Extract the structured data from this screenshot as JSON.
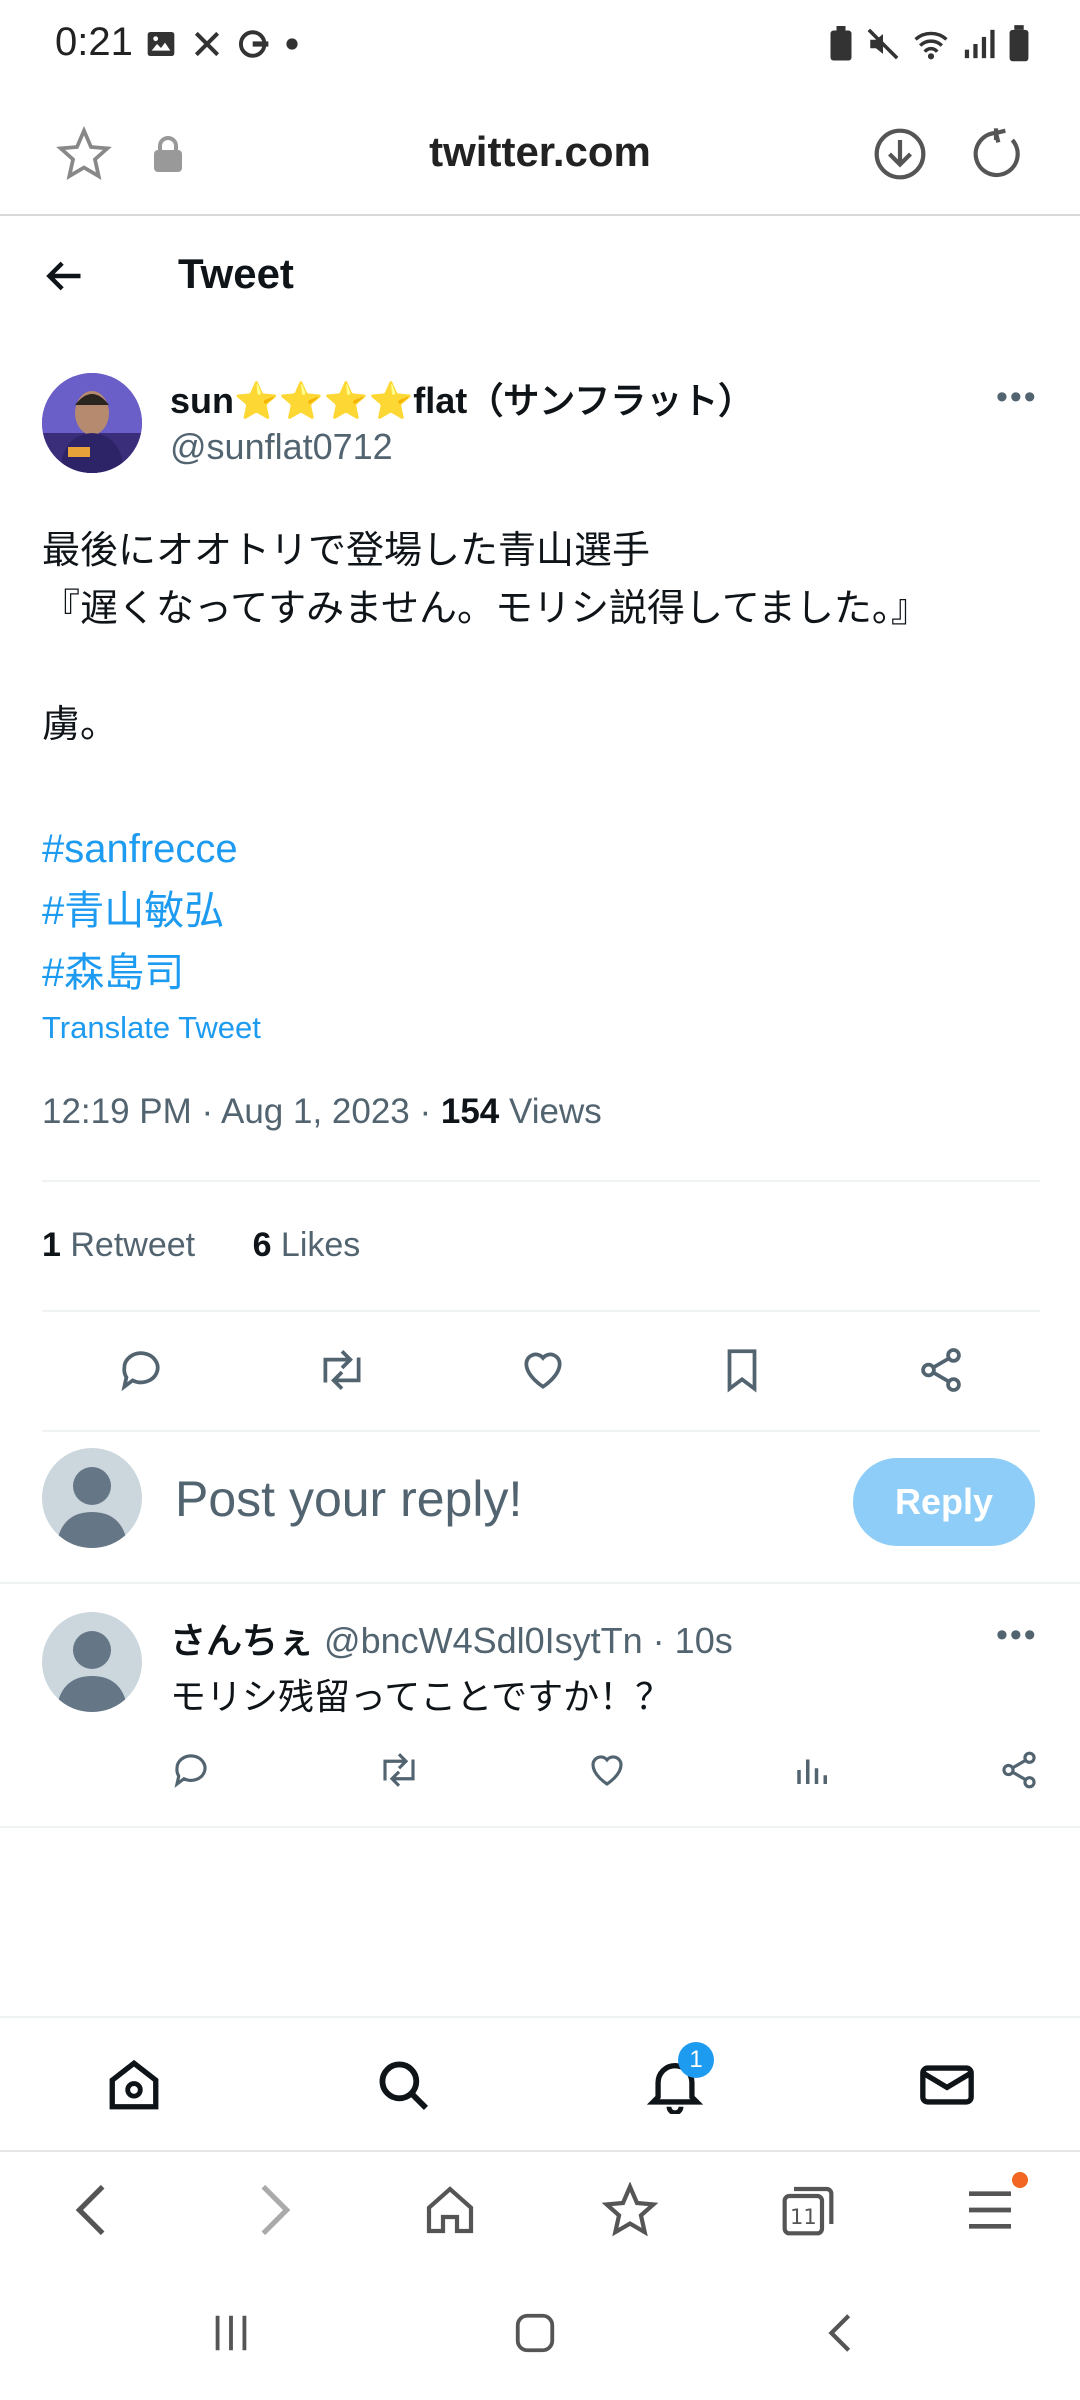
{
  "status_bar": {
    "time": "0:21"
  },
  "browser": {
    "url": "twitter.com"
  },
  "header": {
    "title": "Tweet"
  },
  "tweet": {
    "author_name": "sun⭐⭐⭐⭐flat（サンフラット）",
    "author_handle": "@sunflat0712",
    "text": "最後にオオトリで登場した青山選手\n『遅くなってすみません。モリシ説得してました。』\n\n虜。",
    "hashtags": [
      "#sanfrecce",
      "#青山敏弘",
      "#森島司"
    ],
    "translate_label": "Translate Tweet",
    "timestamp": "12:19 PM · Aug 1, 2023 · ",
    "views_count": "154",
    "views_label": " Views",
    "retweets_count": "1",
    "retweets_label": " Retweet",
    "likes_count": "6",
    "likes_label": " Likes"
  },
  "reply_composer": {
    "placeholder": "Post your reply!",
    "button_label": "Reply"
  },
  "comment": {
    "name": "さんちぇ",
    "handle": " @bncW4Sdl0IsytTn · 10s",
    "text": "モリシ残留ってことですか！？"
  },
  "bottom_nav": {
    "notifications_badge": "1"
  },
  "colors": {
    "link": "#1d9bf0",
    "reply_button": "#8ecdf8",
    "secondary_text": "#536471"
  }
}
